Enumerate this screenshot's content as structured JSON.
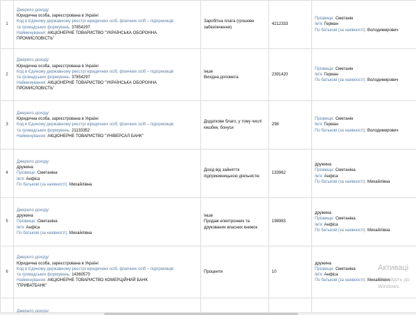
{
  "labels": {
    "source": "Джерело доходу:",
    "legal": "Юридична особа, зареєстрована в Україні",
    "code": "Код в Єдиному державному реєстрі юридичних осіб, фізичних осіб – підприємців та громадських формувань:",
    "name": "Найменування:",
    "spouse": "дружина",
    "surname": "Прізвище:",
    "firstname": "Ім'я:",
    "patronymic": "По батькові (за наявності):"
  },
  "rows": [
    {
      "num": "1",
      "source_kind": "legal",
      "code": "37854297",
      "name": "АКЦІОНЕРНЕ ТОВАРИСТВО \"УКРАЇНСЬКА ОБОРОННА ПРОМИСЛОВІСТЬ\"",
      "type_lines": [
        "Заробітна плата (грошове забезпечення)"
      ],
      "amount": "4212333",
      "person": {
        "relation": "",
        "surname": "Сметанін",
        "firstname": "Герман",
        "patronymic": "Володимирович"
      }
    },
    {
      "num": "2",
      "source_kind": "legal",
      "code": "37854297",
      "name": "АКЦІОНЕРНЕ ТОВАРИСТВО \"УКРАЇНСЬКА ОБОРОННА ПРОМИСЛОВІСТЬ\"",
      "type_lines": [
        "Інше",
        "Вихідна допомога"
      ],
      "amount": "2391420",
      "person": {
        "relation": "",
        "surname": "Сметанін",
        "firstname": "Герман",
        "patronymic": "Володимирович"
      }
    },
    {
      "num": "3",
      "source_kind": "legal",
      "code": "21133352",
      "name": "АКЦІОНЕРНЕ ТОВАРИСТВО \"УНІВЕРСАЛ БАНК\"",
      "type_lines": [
        "Додаткове благо, у тому числі кешбек, бонуси"
      ],
      "amount": "298",
      "person": {
        "relation": "",
        "surname": "Сметанін",
        "firstname": "Герман",
        "patronymic": "Володимирович"
      }
    },
    {
      "num": "4",
      "source_kind": "person",
      "surname": "Сметаніна",
      "firstname": "Анфіса",
      "patronymic": "Михайлівна",
      "type_lines": [
        "Дохід від зайняття підприємницькою діяльністю"
      ],
      "amount": "133962",
      "person": {
        "relation": "дружина",
        "surname": "Сметаніна",
        "firstname": "Анфіса",
        "patronymic": "Михайлівна"
      }
    },
    {
      "num": "5",
      "source_kind": "person",
      "surname": "Сметаніна",
      "firstname": "Анфіса",
      "patronymic": "Михайлівна",
      "type_lines": [
        "Інше",
        "Продаж електронних та друкованих власних книжок"
      ],
      "amount": "198983",
      "person": {
        "relation": "дружина",
        "surname": "Сметаніна",
        "firstname": "Анфіса",
        "patronymic": "Михайлівна"
      }
    },
    {
      "num": "6",
      "source_kind": "legal",
      "code": "14360570",
      "name": "АКЦІОНЕРНЕ ТОВАРИСТВО КОМЕРЦІЙНИЙ БАНК \"ПРИВАТБАНК\"",
      "type_lines": [
        "Проценти"
      ],
      "amount": "10",
      "person": {
        "relation": "дружина",
        "surname": "Сметаніна",
        "firstname": "Анфіса",
        "patronymic": "Михайлівна"
      }
    },
    {
      "num": "",
      "source_kind": "partial",
      "type_lines": [],
      "amount": "",
      "person": {
        "relation": "",
        "surname": "",
        "firstname": "",
        "patronymic": ""
      }
    }
  ],
  "watermark": {
    "title": "Активаці",
    "line1": "Перейдіть до",
    "line2": "Windows."
  }
}
